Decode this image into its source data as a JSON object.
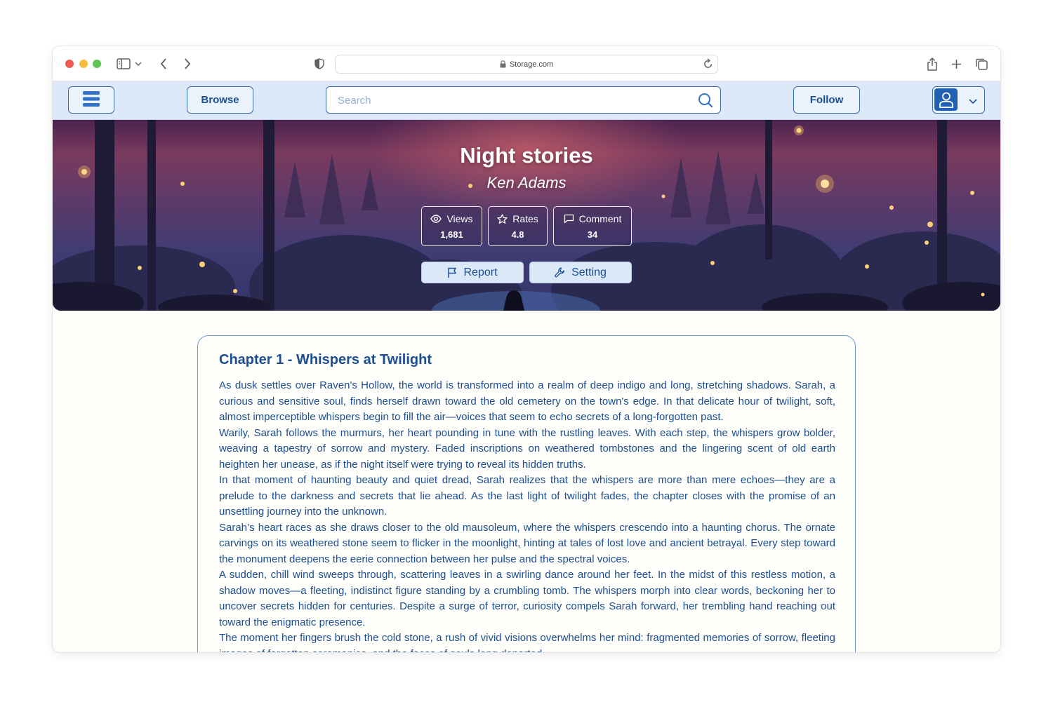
{
  "browser": {
    "url": "Storage.com"
  },
  "navbar": {
    "browse_label": "Browse",
    "search_placeholder": "Search",
    "follow_label": "Follow"
  },
  "hero": {
    "title": "Night stories",
    "author": "Ken Adams",
    "stats": {
      "views": {
        "label": "Views",
        "value": "1,681"
      },
      "rates": {
        "label": "Rates",
        "value": "4.8"
      },
      "comment": {
        "label": "Comment",
        "value": "34"
      }
    },
    "actions": {
      "report_label": "Report",
      "setting_label": "Setting"
    }
  },
  "chapter": {
    "title": "Chapter 1 - Whispers at Twilight",
    "paragraphs": [
      "As dusk settles over Raven's Hollow, the world is transformed into a realm of deep indigo and long, stretching shadows. Sarah, a curious and sensitive soul, finds herself drawn toward the old cemetery on the town's edge. In that delicate hour of twilight, soft, almost imperceptible whispers begin to fill the air—voices that seem to echo secrets of a long-forgotten past.",
      "Warily, Sarah follows the murmurs, her heart pounding in tune with the rustling leaves. With each step, the whispers grow bolder, weaving a tapestry of sorrow and mystery. Faded inscriptions on weathered tombstones and the lingering scent of old earth heighten her unease, as if the night itself were trying to reveal its hidden truths.",
      "In that moment of haunting beauty and quiet dread, Sarah realizes that the whispers are more than mere echoes—they are a prelude to the darkness and secrets that lie ahead. As the last light of twilight fades, the chapter closes with the promise of an unsettling journey into the unknown.",
      "Sarah’s heart races as she draws closer to the old mausoleum, where the whispers crescendo into a haunting chorus. The ornate carvings on its weathered stone seem to flicker in the moonlight, hinting at tales of lost love and ancient betrayal. Every step toward the monument deepens the eerie connection between her pulse and the spectral voices.",
      "A sudden, chill wind sweeps through, scattering leaves in a swirling dance around her feet. In the midst of this restless motion, a shadow moves—a fleeting, indistinct figure standing by a crumbling tomb. The whispers morph into clear words, beckoning her to uncover secrets hidden for centuries. Despite a surge of terror, curiosity compels Sarah forward, her trembling hand reaching out toward the enigmatic presence.",
      "The moment her fingers brush the cold stone, a rush of vivid visions overwhelms her mind: fragmented memories of sorrow, fleeting images of forgotten ceremonies, and the faces of souls long departed."
    ]
  }
}
